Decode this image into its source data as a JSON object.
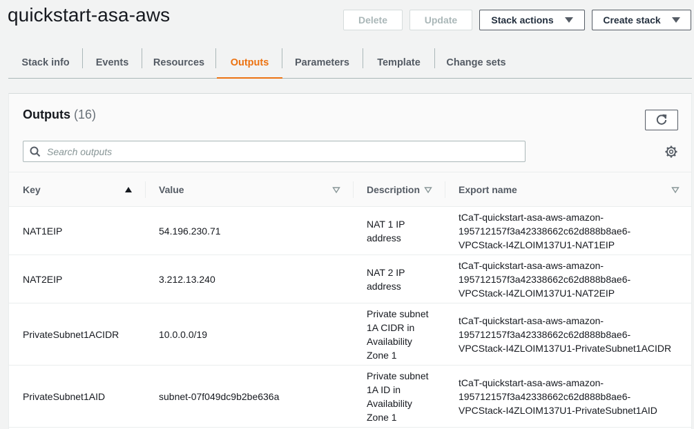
{
  "header": {
    "title": "quickstart-asa-aws",
    "buttons": {
      "delete": "Delete",
      "update": "Update",
      "stack_actions": "Stack actions",
      "create_stack": "Create stack"
    }
  },
  "tabs": [
    {
      "label": "Stack info",
      "active": false
    },
    {
      "label": "Events",
      "active": false
    },
    {
      "label": "Resources",
      "active": false
    },
    {
      "label": "Outputs",
      "active": true
    },
    {
      "label": "Parameters",
      "active": false
    },
    {
      "label": "Template",
      "active": false
    },
    {
      "label": "Change sets",
      "active": false
    }
  ],
  "outputs": {
    "title": "Outputs",
    "count": "(16)",
    "search_placeholder": "Search outputs",
    "columns": {
      "key": "Key",
      "value": "Value",
      "description": "Description",
      "export_name": "Export name"
    },
    "rows": [
      {
        "key": "NAT1EIP",
        "value": "54.196.230.71",
        "description": [
          "NAT 1 IP",
          "address"
        ],
        "export_name": [
          "tCaT-quickstart-asa-aws-amazon-",
          "195712157f3a42338662c62d888b8ae6-",
          "VPCStack-I4ZLOIM137U1-NAT1EIP"
        ]
      },
      {
        "key": "NAT2EIP",
        "value": "3.212.13.240",
        "description": [
          "NAT 2 IP",
          "address"
        ],
        "export_name": [
          "tCaT-quickstart-asa-aws-amazon-",
          "195712157f3a42338662c62d888b8ae6-",
          "VPCStack-I4ZLOIM137U1-NAT2EIP"
        ]
      },
      {
        "key": "PrivateSubnet1ACIDR",
        "value": "10.0.0.0/19",
        "description": [
          "Private subnet",
          "1A CIDR in",
          "Availability",
          "Zone 1"
        ],
        "export_name": [
          "tCaT-quickstart-asa-aws-amazon-",
          "195712157f3a42338662c62d888b8ae6-",
          "VPCStack-I4ZLOIM137U1-PrivateSubnet1ACIDR"
        ]
      },
      {
        "key": "PrivateSubnet1AID",
        "value": "subnet-07f049dc9b2be636a",
        "description": [
          "Private subnet",
          "1A ID in",
          "Availability",
          "Zone 1"
        ],
        "export_name": [
          "tCaT-quickstart-asa-aws-amazon-",
          "195712157f3a42338662c62d888b8ae6-",
          "VPCStack-I4ZLOIM137U1-PrivateSubnet1AID"
        ]
      }
    ]
  },
  "colors": {
    "accent": "#ec7211",
    "text": "#16191f",
    "muted": "#545b64",
    "border": "#aab7b8",
    "background": "#f2f3f3"
  }
}
